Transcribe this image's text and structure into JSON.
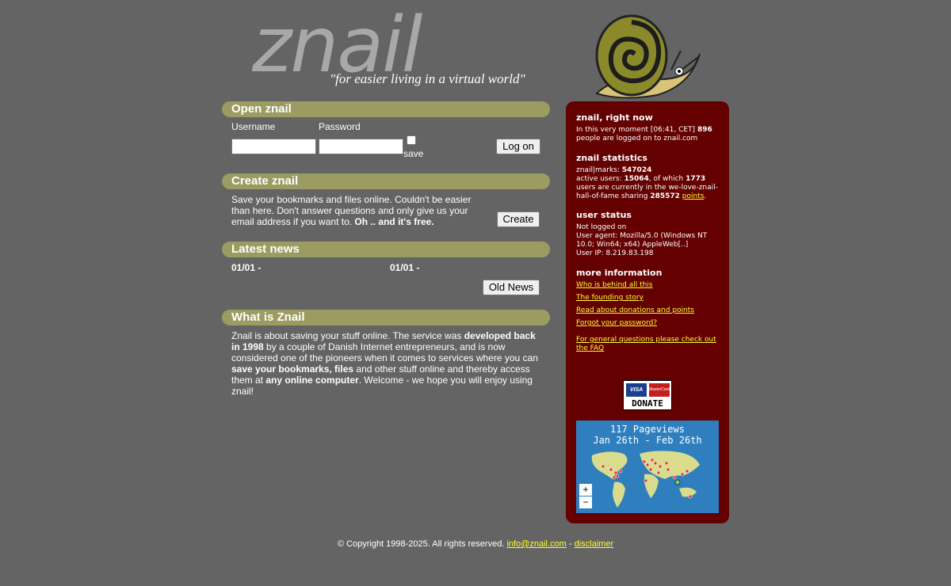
{
  "header": {
    "logo": "znail",
    "tagline": "\"for easier living in a virtual world\""
  },
  "open": {
    "title": "Open znail",
    "username_label": "Username",
    "password_label": "Password",
    "save_label": "save",
    "login_button": "Log on"
  },
  "create": {
    "title": "Create znail",
    "text_1": "Save your bookmarks and files online. Couldn't be easier than here. Don't answer questions and only give us your email address if you want to. ",
    "text_bold": "Oh .. and it's free.",
    "button": "Create"
  },
  "news": {
    "title": "Latest news",
    "item_1": "01/01 -",
    "item_2": "01/01 -",
    "button": "Old News"
  },
  "what": {
    "title": "What is Znail",
    "p1": "Znail is about saving your stuff online. The service was ",
    "b1": "developed back in 1998",
    "p2": " by a couple of Danish Internet entrepreneurs, and is now considered one of the pioneers when it comes to services where you can ",
    "b2": "save your bookmarks, files",
    "p3": " and other stuff online and thereby access them at ",
    "b3": "any online computer",
    "p4": ". Welcome - we hope you will enjoy using znail!"
  },
  "right": {
    "now_title": "znail, right now",
    "now_text_1": "In this very moment [06:41, CET] ",
    "now_count": "896",
    "now_text_2": " people are logged on to znail.com",
    "stats_title": "znail statistics",
    "marks_label": "znail|marks: ",
    "marks_value": "547024",
    "active_label": "active users: ",
    "active_value": "15064",
    "which_label": ", of which ",
    "which_value": "1773",
    "hof_text": " users are currently in the we-love-znail-hall-of-fame sharing ",
    "points_value": "285572",
    "points_link": "points",
    "points_end": ".",
    "status_title": "user status",
    "status_1": "Not logged on",
    "status_2": "User agent: Mozilla/5.0 (Windows NT 10.0; Win64; x64) AppleWeb[..]",
    "status_3": "User IP: 8.219.83.198",
    "more_title": "more information",
    "link_1": "Who is behind all this",
    "link_2": "The founding story",
    "link_3": "Read about donations and points",
    "link_4": "Forgot your password?",
    "link_5": "For general questions please check out the FAQ",
    "donate_label": "DONATE",
    "visa": "VISA",
    "mastercard": "MasterCard",
    "map_line_1": "117 Pageviews",
    "map_line_2": "Jan 26th - Feb 26th",
    "zoom_in": "+",
    "zoom_out": "−"
  },
  "footer": {
    "copyright": "© Copyright 1998-2025. All rights reserved. ",
    "email": "info@znail.com",
    "sep": " - ",
    "disclaimer": "disclaimer"
  }
}
